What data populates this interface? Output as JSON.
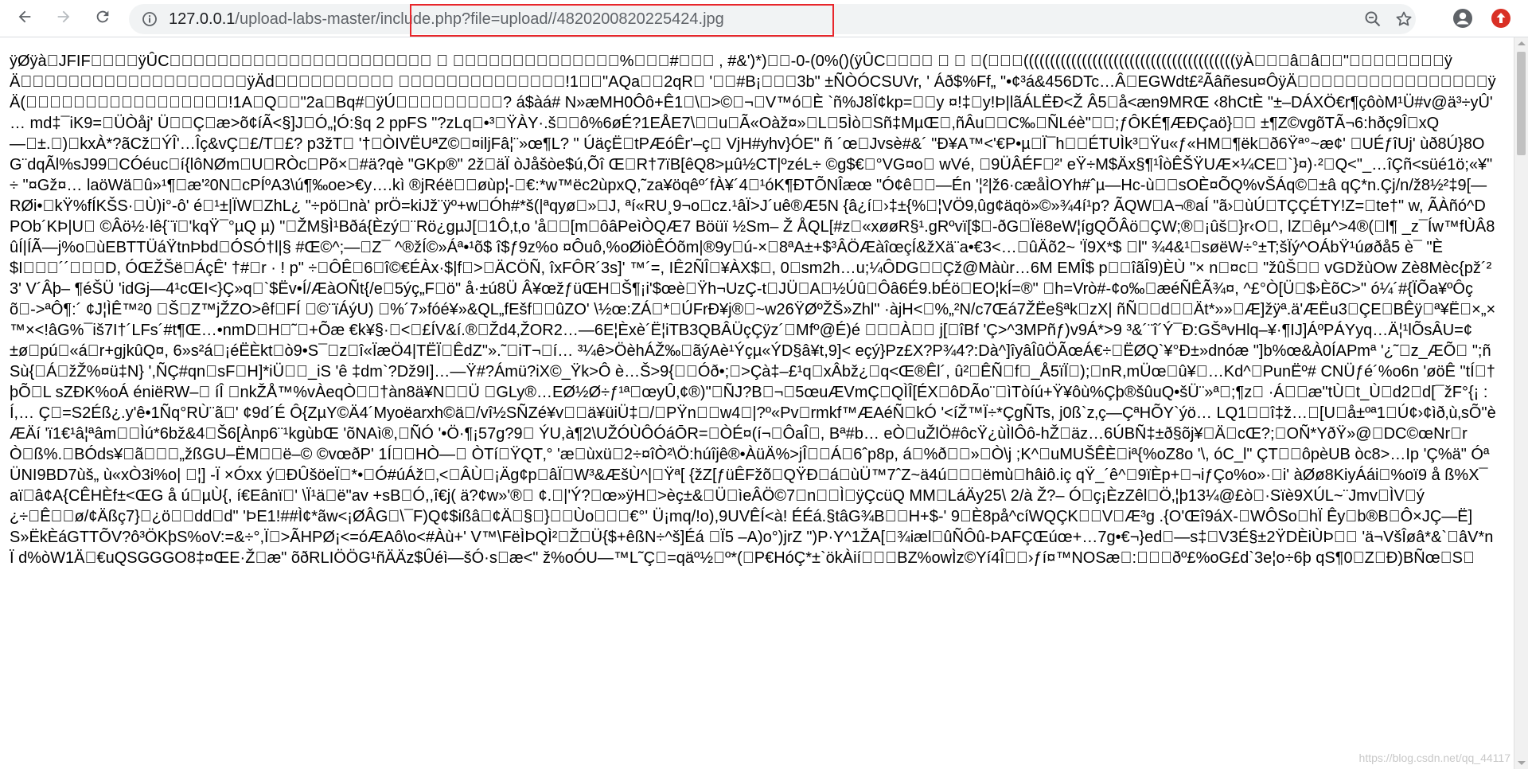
{
  "browser": {
    "url_host": "127.0.0.1",
    "url_path": "/upload-labs-master/include.php?file=upload//4820200820225424.jpg",
    "highlight_color": "#e8262b",
    "icons": [
      "back-arrow-icon",
      "forward-arrow-icon",
      "reload-icon",
      "info-icon",
      "zoom-icon",
      "bookmark-star-icon",
      "profile-icon",
      "update-icon"
    ]
  },
  "page": {
    "raw_text": "ÿØÿà\u0000JFIF\u0000\u0000\u0000\u0000ÿÛC\u0000\u0000\u0000\u0000\u0000\u0000\u0000\u0000\u0000\u0000\u0000\u0000\u0000\u0000\u0000\u0000\u0000\u0000\u0000\u0000\u0000\u0000 \u0000 \u0000\u0000\u0000\u0000\u0000\u0000\u0000\u0000\u0000\u0000\u0000\u0000\u0000\u0000%\u0000\u0000\u0000#\u0000\u0000\u0000 , #&')*)\u0000\u0000-0-(0%()(ÿÛC\u0000\u0000\u0000\u0000 \u0000 \u0000 \u0000(\u0000\u0000\u0000((((((((((((((((((((((((((((((((((((((((ÿÀ\u0000\u0000\u0000â\u0000â\u0000\u0000\"\u0000\u0000\u0000\u0000\u0000\u0000\u0000\u0000ÿÄ\u0000\u0000\u0000\u0000\u0000\u0000\u0000\u0000\u0000\u0000\u0000\u0000\u0000\u0000\u0000\u0000\u0000\u0000\u0000ÿÄd\u0000\u0000\u0000\u0000\u0000\u0000\u0000\u0000\u0000\u0000 \u0000\u0000\u0000\u0000\u0000\u0000\u0000\u0000\u0000\u0000\u0000\u0000\u0000\u0000!1\u0000\u0000\"AQa\u0000\u00002qR\u0000 '\u0000\u0000#B¡\u0000\u0000\u00003b\" ±ÑÒÓCSUVr, ' Áð$%Ff„ \"•¢³á&456DTc…Â\u0000EGWdt£²Ãâñesu¤ÔÿÄ\u0000\u0000\u0000\u0000\u0000\u0000\u0000\u0000\u0000\u0000\u0000\u0000\u0000\u0000\u0000\u0000ÿÄ(\u0000\u0000\u0000\u0000\u0000\u0000\u0000\u0000\u0000\u0000\u0000\u0000\u0000\u0000\u0000\u0000\u0000!1A\u0000Q\u0000\u0000\"2a\u0000Bq#\u0000ÿÚ\u0000\u0000\u0000\u0000\u0000\u0000\u0000\u0000\u0000? á$àá# N»æMH0Ôô+Ê1\u0000\\\u0000>©\u0000¬\u0000V™ó\u0000È `ñ%J8Ï¢kp=\u0000\u0000y ¤!‡\u0000y!Þ|lãÁLËÐ<Ž Â5\u0000å<æn9MRŒ ‹8hCtÈ \"±–DÁXÖ€r¶çôòM¹Ü#v@ä³÷yÛ' … md‡¯iK9=\u0000ÜÒåj' Ü\u0000\u0000Ç\u0000æ>õ¢íÃ<§]J\u0000Ó„¦Ó:§q 2 ppFS \"?zLq\u0000•³\u0000ŸÀY·.š\u0000\u0000ô%6øÉ?1EÅE7\\\u0000\u0000u\u0000Ã«Oàž¤»\u0000L\u00005Ìò\u0000Sñ‡MµŒ\u0000,ñÂu\u0000\u0000C‰\u0000ÑLéè\"\u0000\u0000;ƒÔKÉ¶ÆÐÇaö}\u0000\u0000 ±¶Z©vgõTÃ¬6:hðç9Î\u0000xQ—\u0000±.\u0000)\u0000kxÀ*?ãCž\u0000ÝÎ'…Îç&vÇ\u0000£/T\u0000£? p3žT\u0000 '†\u0000ÒIVËUªZ©\u0000¤iljFâ¦¨»œ¶L? \" ÚäçË\u0000tPÆóÊr'–ç\u0000 VjH#yhv}ÓE\" ñ ´œ\u0000Jvsè#&´ \"Ð¥A™<'€P•µ\u0000Ï¯h\u0000\u0000ÉTUÌk³\u0000Ÿu«ƒ«HM\u0000¶ëk\u0000ð6Ÿª°~æ¢' \u0000UÉƒîUj' ùð8Ú}8OG¨dqÃl%sJ99\u0000CÓéuc\u0000í{lôNØm\u0000U\u0000RÒc\u0000Põ×\u0000#ä?qè \"GKp®\" 2ž\u0000äÏ òJåšòe$ú,Õî Œ\u0000R†7ïB[êQ8>µû½CT|ºzéL÷ ©g$€\u0000°VG¤o\u0000 wVé, \u00009ÜÂÉF\u0000²' eŸ÷M$Äx§¶¹ÎòÊŠŸUÆ×¼CE\u0000`}¤)·²\u0000Q<\"_…îÇñ<süé1ö;«¥\" ÷ \"¤Gž¤… laöWä\u0000û»¹¶\u0000æ'²0N\u0000cPÍºA3\\ú¶‰oe>€y….kì ®jRéë\u0000\u0000øùp¦-\u0000€:*w™ëc2ùpxQ,˜za¥öqêº´fÀ¥´4\u0000¹óK¶ÐTÕNÎæœ \"Ó¢ê\u0000\u0000—Én '¦²|ž6·cæåÌOYh#ˆµ—Hc-ù\u0000\u0000sOÈ¤ÕQ%vŠÁq©\u0000±â qÇ*n.Çj/n/ž8½²‡9[—RØi•\u0000kŸ%fÍKŠS·\u0000Ù)i°-ô' é\u0000¹±|ÏW\u0000ZhL¿ \"÷pö\u0000nà' prÖ=kiJž¨ÿº+w\u0000Óh#*š(|ªqyø\u0000»\u0000J, ªí«RU¸9¬o\u0000cz.¹âÏ>J´uê®Æ5N {â¿í\u0000›‡±{%\u0000¦VÖ9‚ûg¢äqö»©»¾4í¹p? ÃQW\u0000A¬®aÍ \"ã›\u0000ùÚ\u0000TÇÇÉTY!Z=\u0000te†\" w, ÃÀñó^DPOb´KÞ|U\u0000 ©Âö½·lê{¨ï\u0000'kqŸ¯°µQ µ) \"\u0000ŽM§Ì¹Bðá{Èzý\u0000¨Rö¿gµJ[\u00001Ô‚t‚o 'å\u0000\u0000[m\u0000ôâPeìÒQÆ7 Böüï ½Sm– Ž ÅQL[#z\u0000«xøøR§¹.gRºvï[$\u0000-ðG\u0000Ïë8eW¦ígQÕÂö\u0000ÇW;®\u0000¡ûš\u0000}r‹O\u0000, lZ\u0000êµ^>4®(\u0000l¶ _z¯Íw™fÙÂ8ûÍ|ÍÃ—j%o\u0000ùEBTTÜáŸtnÞbd\u0000ÓSÓ†l|§ #Œ©^;—\u0000Z¯ ^®žÍ©»Áª•¹õ$ î$ƒ9z%o ¤Ôuô,%oØiòÊÓõm|®9y\u0000ú-×\u00008ªA±+$³ÂÖÆàîœçÍ&žXä¨a•€3<…\u0000ûÄõ2~ 'Ï9X*$ \u0000l\" ¾4&¹\u0000søëW÷°±T;šÏý^OÁbŸ¹úøðå5 è¯ \"È$I\u0000\u0000\u0000´´\u0000\u0000\u0000D, ÓŒŽŠë\u0000ÁçÊ' †#\u0000r · ! p\" ÷\u0000ÔÊ\u00006\u0000î©€ÉÀx·$|f\u0000>\u0000ÄCÖÑ, îxFÔR´3s]' ™´=, IÊ2ÑÎ\u0000¥ÀX$\u0000, 0\u0000sm2h…u;¼ÔDG\u0000\u0000Çž@Màùr…6M EMÎ$ p\u0000\u0000îãÎ9)ÈÙ \"× n\u0000¤c\u0000 \"žûŠ\u0000\u0000 vGDžùOw Zè8Mèc{pž´²3' V´Âþ– ¶éŠÜ 'idGj—4¹cŒI<}Ç»q\u0000`$Ëv•Í/ÆàOÑt{/e\u00005ýç„F\u0000ö\" å·±ú8Ü Â¥œžƒüŒH\u0000Š¶¡i'$œè\u0000Ÿh¬UzÇ-t\u0000JÜ\u0000A\u0000½Úû\u0000Ôâ6É9.bÉö\u0000EO¦kÍ=®\" \u0000h=Vrò#-¢o‰\u0000æéÑÊÃ¾¤, ^£°Ò[Ü\u0000$›ÈõC>\" ó¼´#{ÏÕa¥ºÔçõ\u0000->ªÔ¶:´ ¢J¦ÌÊ™²0 \u0000Š\u0000Z™jŽZO>êf\u0000FÍ \u0000©¨ïÁýU) \u0000%´7»fóé¥»&QL„fEšf\u0000\u0000ûZO' \\½œ:ZÁ\u0000*\u0000ÚFrÐ¥j®\u0000~w26ŸØºŽŠ»Zhl\" ·àjH<\u0000%„²N/c7Œá7ŽËe§ªk\u0000zX| ñÑ\u0000\u0000d\u0000\u0000Ät*»»\u0000Æ]žÿª.ä'ÆËu3\u0000ÇE\u0000BÊÿ\u0000ª¥Ë\u0000×„×™×<!âG%¯iš7I†´LFs´#t¶Œ…•nmD\u0000H\u0000˜\u0000+Õæ €k¥§·\u0000<\u0000£ÍV&í.®\u0000Žd4‚ŽOR2…—6E¦Èxè´Ë¦iTB3QBÂÜçÇÿz´\u0000Mfº@É)é \u0000\u0000\u0000À\u0000\u0000 j[\u0000îBf 'Ç>^3MPñƒ)v9Á*>9 ³&´¨î´Ý¯Ð:GŠªvHlq–¥·¶IJ]ÁºPÁYyq…Ä¦¹lÕsÂU=¢±ø\u0000pú\u0000«á\u0000r+gjkûQ¤, 6»s²á\u0000¡éËÈkt\u0000ò9•S¯\u0000z\u0000î«ÏæÖ4|TËÏ\u0000ÊdZ\"».˜\u0000iT¬\u0000í… ³¼ê>ÖèhÁŽ‰\u0000ãýAè¹Ýçµ«ÝD§â¥t,9]< eçý}Pz£X?P¾4?:Dà^]îyâÎûÖÃœÁ€÷\u0000ËØQ`¥°Ð±»dnóæ \"]b%œ&À0ÍAPmª '¿˜\u0000z_ÆÕ\u0000 \";ñSù{\u0000Á\u0000žŽ%¤ü‡N} ',ÑÇ#qn\u0000sF\u0000H]*iÜ\u0000\u0000_iS 'ê ‡dm`?Dž9I]…—Ÿ#?Ámü?iX©_Ÿk>Ô è…Š>9{\u0000\u0000Óð•;\u0000>Çà‡–£¹q\u0000xÂbž¿\u0000q<Œ®Êl´, û²\u0000ÊÑ\u0000f\u0000_Å5ïÏ\u0000);\u0000nR,mÜœ\u0000û¥\u0000…Kd^\u0000PunËº# CNÜƒé´%o6n 'øöÊ \"tÍ\u0000†þÕ\u0000L sZÐK%oÁ éniëRW–\u0000 íÎ \u0000nkŽÅ™%vÀeqÒ\u0000\u0000†àn8ä¥N\u0000\u0000Ü \u0000GLy®…EØ½Ø÷ƒ¹ª\u0000œyÛ‚¢®)\"\u0000ÑJ?B\u0000¬\u00005œuÆVmÇ\u0000QÌÎ[ÉX\u0000ôDÃo¨\u0000ìTòíú+Ÿ¥ôù%Çþ®šûuQ•šÜ¨»ª\u0000;¶z\u0000 ·Á\u0000\u0000æ\"tÙ\u0000t_Ù\u0000d2\u0000d[¯žF°{¡ :Í,… Ç\u0000=S2Éß¿.y'ê•1Ñq°RÙ¨ã\u0000' ¢9d´É Ô{ZµY©Ä4´Myoëarxh©ä\u0000/vî½SÑZé¥v\u0000\u0000ä¥üiÜ‡\u0000/\u0000PŸn\u0000\u0000w4\u0000|?º«Pv\u0000rmkf™ÆAéÑ\u0000kÓ '<íŽ™Ï÷*ÇgÑTs, j0ß`z‚ç—ÇªHÕY`ýö… LQ1\u0000\u0000î‡ž…\u0000[U\u0000å±ºª1\u0000Ú¢›¢ìð‚ù‚sÕ\"èÆÄí 'ï1€¹â¦ªâm\u0000\u0000Ìú*6bž&4\u0000Š6[Ànp6¨¹kgùbŒ 'õNAì®,\u0000ÑÓ '•Ö·¶¡57g?9\u0000 ÝU,à¶2\\UŽÓÙÔÓáŌR=\u0000ÒÉ¤(í¬\u0000ÔaÎ\u0000, Bª#b… eÒ\u0000uŽlÖ#ôcŸ¿ùÌlÔô-hŽ\u0000äz…6ÚBÑ‡±ð§õj¥\u0000Ä\u0000cŒ?;\u0000OÑ*YðŸ»@\u0000DC©œNr\u0000rÒ\u0000ß%.\u0000BÓds¥\u0000ã\u0000\u0000\u0000„žßGU–ËM\u0000\u0000ë–© ©vœðP' 1Í\u0000\u0000HÒ—\u0000 ÒTí\u0000ŸQT‚° 'æ\u0000ùxü\u00002÷¤îÒ²\\Ö:húîjê®•ÀüÄ%>jÎ\u0000\u0000Á\u00006ˆp8p, á\u0000%ð\u0000\u0000»\u0000Ò\\j ;K^\u0000uMUŠÊÈ\u0000iª{%oZ8o '\\, óC_l\" ÇT\u0000\u0000ôpèUB òc8>…Ip 'Ç%ä\" ÓªÜNI9BD7ùš„ ù«xÒ3i%o| \u0000¦] -Ï ×Óxx ý\u0000ÐÛšöeÏ\u0000*•\u0000Ó#úÁž\u0000‚<\u0000ÂÙ\u0000¡Äg¢p\u0000âÏ\u0000W³&ÆšÙ^|\u0000Ÿª[ {žZ[ƒüÊFžõ\u0000QŸÐ\u0000á\u0000ùÜ™7ˆZ~ä4ú\u0000\u0000\u0000ëmù\u0000hâiô.iç qŸ_´ê^\u00009ïÈp+\u0000¬iƒÇo%o»·\u0000i' àØø8KiyÁái\u0000%oï9 å ß%X¯aï\u0000â¢A{CÊHÈf±<ŒG å ú\u0000µÙ{, í€Eânï\u0000' \\Ï¹ä\u0000ë\"av +sB\u0000Ó,,î€j( ä?¢w»'®\u0000 ¢.\u0000|'Ý?\u0000œ»ÿH\u0000>èç±&\u0000Ü\u0000ìeÂÖ©7\u0000n\u0000\u0000Ì\u0000ÿÇcüQ MM\u0000LáÄy25\\ 2/à Ž?– Ó\u0000ç¡ÈzZêl\u0000Ö‚¦þ13¼@£ò\u0000·Sïè9XÚL~¨Jmv\u0000ÌV\u0000ý¿÷\u0000Ê\u0000\u0000ø/¢Äßç7}\u0000¿ö\u0000\u0000dd\u0000d\" 'ÞE1!##Ì¢*ãw<¡ØÂG\u0000\\¯F)Q¢$ißâ\u0000¢Ä\u0000§\u0000}\u0000\u0000Ùo\u0000\u0000\u0000€°' Ü¡mq/!o),9UVÊÍ<à! ÉÉá.§tâG¾B\u0000\u0000H+$-' 9\u0000È8på^cíWQÇK\u0000\u0000V\u0000Æ³g .{O'Œî9áX-\u0000WÔSo\u0000hÏ Êy\u0000b®B\u0000Ô×JÇ—Ë]S»ËkÈáGTTÕV?ô³ÖKþS%oV:=&÷°,Ï\u0000>ÃHPØ¡<=óÆAô\\o<#Àù+' V™\\FëÌÞQÌ²\u0000Ž\u0000Ü{$+êßN÷^š]Éá \u0000Ï5 –A)o°)jrZ \")P·Y^1ŽA[\u0000¾iæl\u0000ûÑÔû-ÞAFÇŒúœ+…7g•€¬}ed\u0000—s‡\u0000V3É§±2ŸDÈiÙÞ\u0000\u0000 'ä¬VšÎøâ*&`\u0000âV*nÏ d%òW1Ä\u0000€uQSGGGO8‡¤ŒE·Ž\u0000æ\" õðRLIÖÖG¹ñÄÄz$Ûéì—šÓ·s\u0000æ<\" ž%oÓU—™L˜Ç\u0000=qäº½\u0000º*(\u0000P€HóÇ*±`ökÀií\u0000\u0000\u0000BZ%owÌz©Yí4Î\u0000\u0000›ƒí¤™NOSæ\u0000:\u0000\u0000\u0000ðº£%oG£d`3e¦o÷6þ qS¶0\u0000Z\u0000Ð)BÑœ\u0000S\u0000",
    "watermark": "https://blog.csdn.net/qq_44117"
  }
}
